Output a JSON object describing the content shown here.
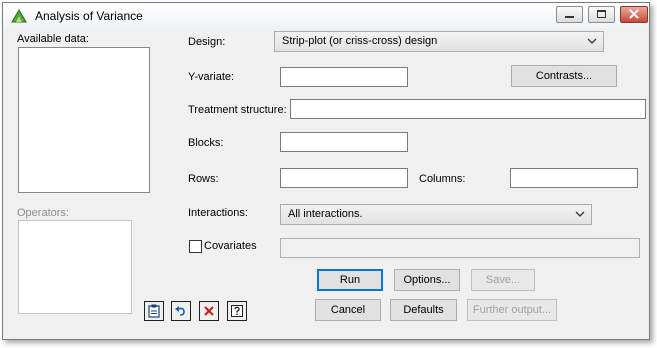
{
  "window": {
    "title": "Analysis of Variance"
  },
  "icons": {
    "app": "green-triangle-icon",
    "minimize": "minimize-icon",
    "maximize": "maximize-icon",
    "close": "close-icon",
    "dropdown": "chevron-down-icon",
    "toolbar": [
      "clipboard-icon",
      "undo-icon",
      "clear-icon",
      "help-icon"
    ]
  },
  "colors": {
    "close_button": "#c84b37",
    "default_button_border": "#0078d7",
    "undo_icon": "#1b5fb5",
    "clear_icon": "#c3201b"
  },
  "left": {
    "available_data_label": "Available data:",
    "operators_label": "Operators:"
  },
  "form": {
    "design_label": "Design:",
    "design_value": "Strip-plot (or criss-cross) design",
    "yvariate_label": "Y-variate:",
    "yvariate_value": "",
    "contrasts_button": "Contrasts...",
    "treatment_label": "Treatment structure:",
    "treatment_value": "",
    "blocks_label": "Blocks:",
    "blocks_value": "",
    "rows_label": "Rows:",
    "rows_value": "",
    "columns_label": "Columns:",
    "columns_value": "",
    "interactions_label": "Interactions:",
    "interactions_value": "All interactions.",
    "covariates_label": "Covariates",
    "covariates_checked": false,
    "covariates_value": ""
  },
  "buttons": {
    "run": "Run",
    "options": "Options...",
    "save": "Save...",
    "cancel": "Cancel",
    "defaults": "Defaults",
    "further_output": "Further output..."
  }
}
